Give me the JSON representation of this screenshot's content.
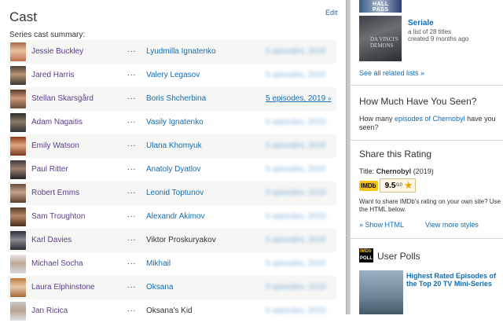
{
  "main": {
    "title": "Cast",
    "edit_label": "Edit",
    "summary_label": "Series cast summary:",
    "dots": "...",
    "cast": [
      {
        "actor": "Jessie Buckley",
        "character": "Lyudmilla Ignatenko",
        "character_link": true,
        "episodes": "5 episodes, 2019",
        "blurred": true
      },
      {
        "actor": "Jared Harris",
        "character": "Valery Legasov",
        "character_link": true,
        "episodes": "5 episodes, 2019",
        "blurred": true
      },
      {
        "actor": "Stellan Skarsgård",
        "character": "Boris Shcherbina",
        "character_link": true,
        "episodes": "5 episodes, 2019",
        "blurred": false
      },
      {
        "actor": "Adam Nagaitis",
        "character": "Vasily Ignatenko",
        "character_link": true,
        "episodes": "5 episodes, 2019",
        "blurred": true
      },
      {
        "actor": "Emily Watson",
        "character": "Ulana Khomyuk",
        "character_link": true,
        "episodes": "5 episodes, 2019",
        "blurred": true
      },
      {
        "actor": "Paul Ritter",
        "character": "Anatoly Dyatlov",
        "character_link": true,
        "episodes": "5 episodes, 2019",
        "blurred": true
      },
      {
        "actor": "Robert Emms",
        "character": "Leonid Toptunov",
        "character_link": true,
        "episodes": "5 episodes, 2019",
        "blurred": true
      },
      {
        "actor": "Sam Troughton",
        "character": "Alexandr Akimov",
        "character_link": true,
        "episodes": "5 episodes, 2019",
        "blurred": true
      },
      {
        "actor": "Karl Davies",
        "character": "Viktor Proskuryakov",
        "character_link": false,
        "episodes": "5 episodes, 2019",
        "blurred": true
      },
      {
        "actor": "Michael Socha",
        "character": "Mikhail",
        "character_link": true,
        "episodes": "5 episodes, 2019",
        "blurred": true
      },
      {
        "actor": "Laura Elphinstone",
        "character": "Oksana",
        "character_link": true,
        "episodes": "5 episodes, 2019",
        "blurred": true
      },
      {
        "actor": "Jan Ricica",
        "character": "Oksana's Kid",
        "character_link": false,
        "episodes": "5 episodes, 2019",
        "blurred": true
      }
    ]
  },
  "sidebar": {
    "list_thumb1_label": "HALL PASS",
    "list_thumb2_label": "DA VINCI'S DEMONS",
    "list_title": "Seriale",
    "list_sub1": "a list of 28 titles",
    "list_sub2": "created 9 months ago",
    "see_all": "See all related lists »",
    "how_many_title": "How Much Have You Seen?",
    "how_many_pre": "How many ",
    "how_many_link": "episodes of Chernobyl",
    "how_many_post": " have you seen?",
    "share_title": "Share this Rating",
    "title_label": "Title: ",
    "title_name": "Chernobyl",
    "title_year": " (2019)",
    "imdb_logo": "IMDb",
    "rating": "9.5",
    "rating_max": "/10",
    "share_text": "Want to share IMDb's rating on your own site? Use the HTML below.",
    "show_html": "Show HTML",
    "view_styles": "View more styles",
    "polls_title": "User Polls",
    "polls_logo_top": "IMDb",
    "polls_logo_bottom": "POLL",
    "poll_link": "Highest Rated Episodes of the Top 20 TV Mini-Series"
  },
  "colors": {
    "link": "#136cb2",
    "visited_link": "#5a3d8a",
    "imdb_yellow": "#f5c518",
    "row_alt": "#f6f6f5"
  }
}
